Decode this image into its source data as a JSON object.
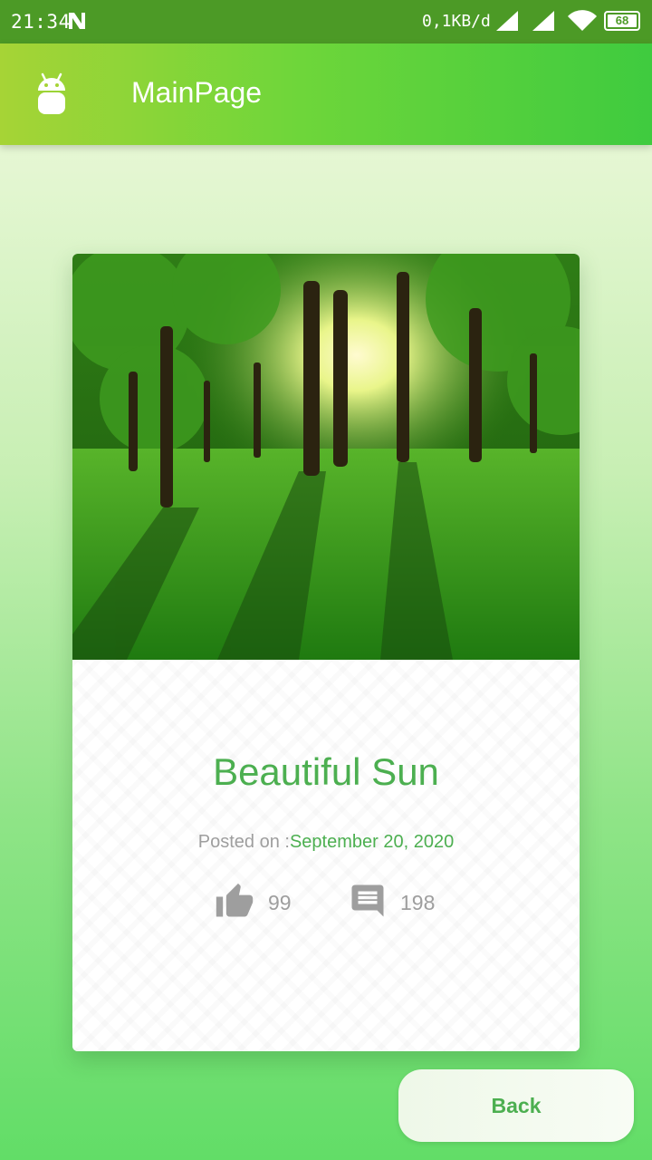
{
  "status_bar": {
    "time": "21:34",
    "network_speed": "0,1KB/d",
    "battery": "68",
    "icons": [
      "notification-n-icon",
      "signal-icon",
      "signal-icon",
      "wifi-icon",
      "battery-icon"
    ]
  },
  "app_bar": {
    "title": "MainPage",
    "logo_icon": "android-icon"
  },
  "card": {
    "image_description_icon": "forest-photo",
    "title": "Beautiful Sun",
    "posted_label": "Posted on :",
    "posted_date": "September 20, 2020",
    "likes": "99",
    "comments": "198"
  },
  "back_button": {
    "label": "Back"
  },
  "colors": {
    "accent": "#4caf50",
    "status_bar": "#4c9a26",
    "muted_text": "#9e9e9e"
  }
}
